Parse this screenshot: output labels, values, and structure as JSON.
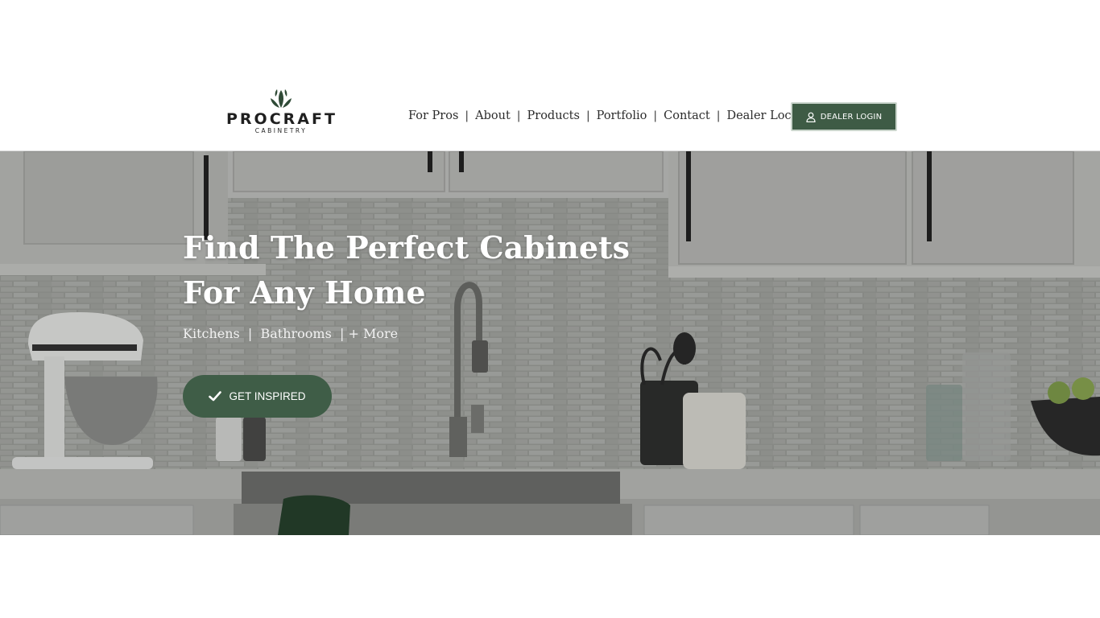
{
  "brand": {
    "name": "PROCRAFT",
    "tagline": "CABINETRY",
    "color": "#2f4a36"
  },
  "nav": {
    "items": [
      "For Pros",
      "About",
      "Products",
      "Portfolio",
      "Contact",
      "Dealer Locator"
    ],
    "separator": "|"
  },
  "login_button": {
    "label": "DEALER LOGIN",
    "icon": "user-icon",
    "color": "#3e5b45"
  },
  "hero": {
    "title": "Find The Perfect Cabinets For Any Home",
    "subtitle": "Kitchens  |  Bathrooms  | + More",
    "cta": {
      "label": "GET INSPIRED",
      "icon": "check-icon",
      "color": "#3f5d47"
    }
  }
}
